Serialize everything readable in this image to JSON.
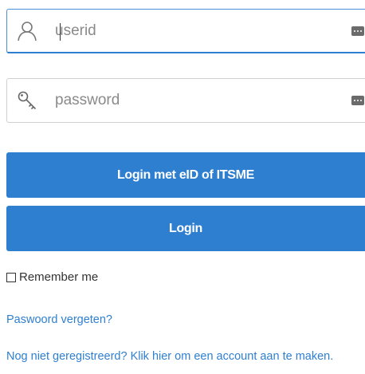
{
  "form": {
    "userid": {
      "value": "",
      "placeholder": "userid"
    },
    "password": {
      "value": "",
      "placeholder": "password"
    },
    "eid_button_label": "Login met eID of ITSME",
    "login_button_label": "Login",
    "remember_label": "Remember me",
    "forgot_link": "Paswoord vergeten?",
    "register_link": "Nog niet geregistreerd? Klik hier om een account aan te maken."
  },
  "icons": {
    "userid": "user-icon",
    "password": "key-icon",
    "autofill": "password-manager-icon"
  },
  "colors": {
    "accent": "#2f7fd1",
    "button_text": "#ffffff",
    "placeholder": "#8a8a8a"
  }
}
